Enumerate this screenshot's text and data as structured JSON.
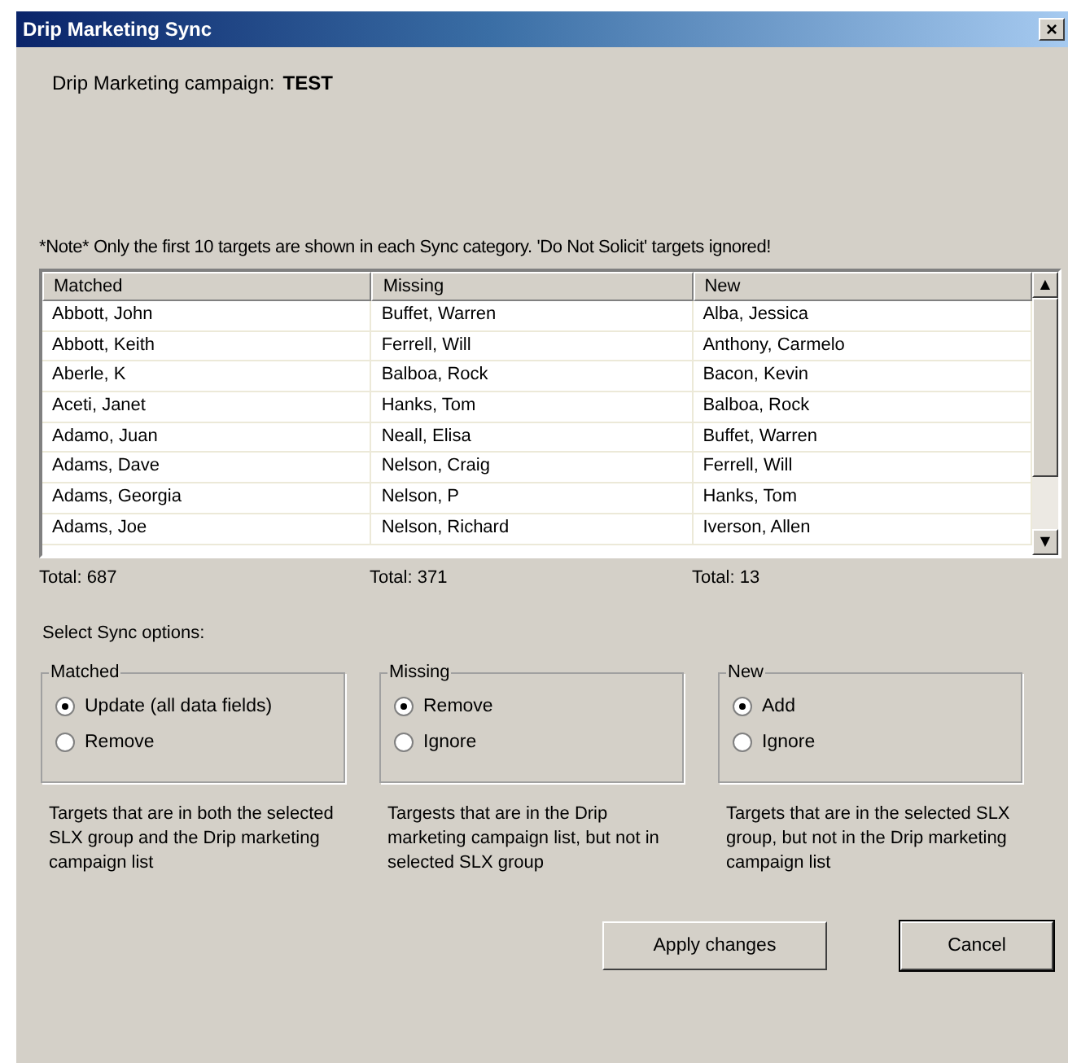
{
  "window": {
    "title": "Drip Marketing Sync",
    "close": "×"
  },
  "campaign": {
    "label": "Drip Marketing campaign:",
    "name": "TEST"
  },
  "note": "*Note* Only the first 10 targets are shown in each Sync category.  'Do Not Solicit' targets ignored!",
  "table": {
    "columns": [
      "Matched",
      "Missing",
      "New"
    ],
    "rows": [
      [
        "Abbott, John",
        "Buffet, Warren",
        "Alba, Jessica"
      ],
      [
        "Abbott, Keith",
        "Ferrell, Will",
        "Anthony, Carmelo"
      ],
      [
        "Aberle, K",
        "Balboa, Rock",
        "Bacon, Kevin"
      ],
      [
        "Aceti, Janet",
        "Hanks, Tom",
        "Balboa, Rock"
      ],
      [
        "Adamo, Juan",
        "Neall, Elisa",
        "Buffet, Warren"
      ],
      [
        "Adams, Dave",
        "Nelson, Craig",
        "Ferrell, Will"
      ],
      [
        "Adams, Georgia",
        "Nelson, P",
        "Hanks, Tom"
      ],
      [
        "Adams, Joe",
        "Nelson, Richard",
        "Iverson, Allen"
      ]
    ],
    "scroll_up": "▲",
    "scroll_down": "▼"
  },
  "totals": [
    "Total: 687",
    "Total: 371",
    "Total: 13"
  ],
  "sync_options_label": "Select Sync options:",
  "groups": [
    {
      "title": "Matched",
      "options": [
        {
          "label": "Update (all data fields)",
          "selected": true
        },
        {
          "label": "Remove",
          "selected": false
        }
      ],
      "description": "Targets that are in both the selected SLX group and the Drip marketing campaign list"
    },
    {
      "title": "Missing",
      "options": [
        {
          "label": "Remove",
          "selected": true
        },
        {
          "label": "Ignore",
          "selected": false
        }
      ],
      "description": "Targests that are in the Drip marketing campaign list, but not in selected SLX group"
    },
    {
      "title": "New",
      "options": [
        {
          "label": "Add",
          "selected": true
        },
        {
          "label": "Ignore",
          "selected": false
        }
      ],
      "description": "Targets that are in the selected SLX group, but not in the Drip marketing campaign list"
    }
  ],
  "buttons": [
    {
      "label": "Apply changes",
      "default": false
    },
    {
      "label": "Cancel",
      "default": true
    }
  ]
}
